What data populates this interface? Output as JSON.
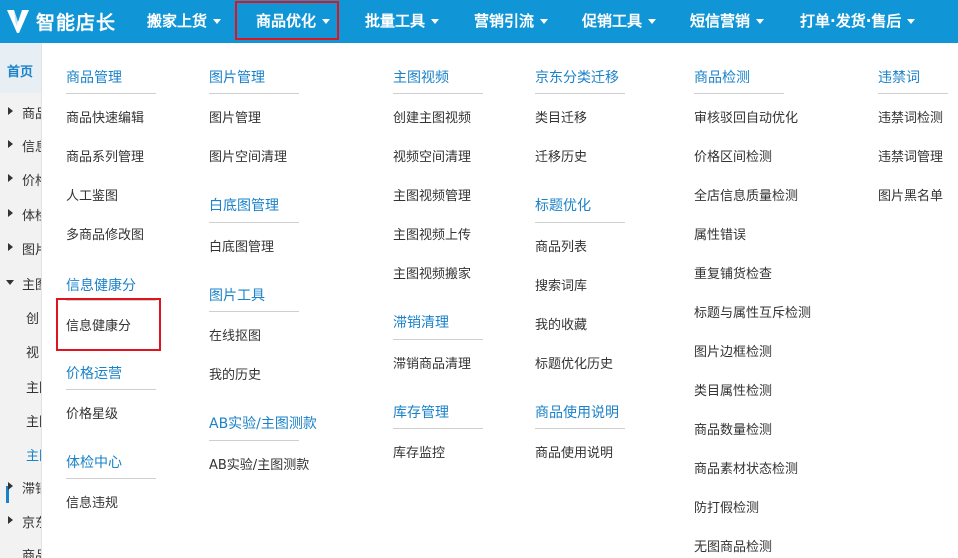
{
  "app": {
    "logo_text": "智能店长"
  },
  "nav": [
    {
      "label": "搬家上货"
    },
    {
      "label": "商品优化"
    },
    {
      "label": "批量工具"
    },
    {
      "label": "营销引流"
    },
    {
      "label": "促销工具"
    },
    {
      "label": "短信营销"
    },
    {
      "label": "打单·发货·售后"
    }
  ],
  "sidebar": {
    "home": "首页",
    "rows": [
      "商品",
      "信息",
      "价格",
      "体检",
      "图片",
      "主图",
      "创",
      "视",
      "主图",
      "主图",
      "主图",
      "滞销",
      "京东",
      "商品"
    ]
  },
  "menu": {
    "col1": {
      "h1": "商品管理",
      "i1": "商品快速编辑",
      "i2": "商品系列管理",
      "i3": "人工鉴图",
      "i4": "多商品修改图",
      "h2": "信息健康分",
      "i5": "信息健康分",
      "h3": "价格运营",
      "i6": "价格星级",
      "h4": "体检中心",
      "i7": "信息违规"
    },
    "col2": {
      "h1": "图片管理",
      "i1": "图片管理",
      "i2": "图片空间清理",
      "h2": "白底图管理",
      "i3": "白底图管理",
      "h3": "图片工具",
      "i4": "在线抠图",
      "i5": "我的历史",
      "h4": "AB实验/主图测款",
      "i6": "AB实验/主图测款"
    },
    "col3": {
      "h1": "主图视频",
      "i1": "创建主图视频",
      "i2": "视频空间清理",
      "i3": "主图视频管理",
      "i4": "主图视频上传",
      "i5": "主图视频搬家",
      "h2": "滞销清理",
      "i6": "滞销商品清理",
      "h3": "库存管理",
      "i7": "库存监控"
    },
    "col4": {
      "h1": "京东分类迁移",
      "i1": "类目迁移",
      "i2": "迁移历史",
      "h2": "标题优化",
      "i3": "商品列表",
      "i4": "搜索词库",
      "i5": "我的收藏",
      "i6": "标题优化历史",
      "h3": "商品使用说明",
      "i7": "商品使用说明"
    },
    "col5": {
      "h1": "商品检测",
      "items": [
        "审核驳回自动优化",
        "价格区间检测",
        "全店信息质量检测",
        "属性错误",
        "重复铺货检查",
        "标题与属性互斥检测",
        "图片边框检测",
        "类目属性检测",
        "商品数量检测",
        "商品素材状态检测",
        "防打假检测",
        "无图商品检测"
      ]
    },
    "col6": {
      "h1": "违禁词",
      "i1": "违禁词检测",
      "i2": "违禁词管理",
      "i3": "图片黑名单"
    }
  },
  "colors": {
    "topbar": "#1096d6",
    "accent": "#1a82c8",
    "highlight": "#e0141e"
  }
}
